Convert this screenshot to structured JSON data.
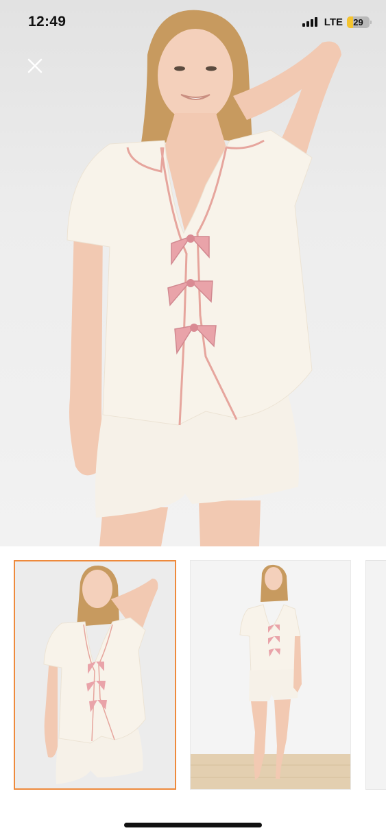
{
  "status_bar": {
    "time": "12:49",
    "network": "LTE",
    "battery": "29"
  },
  "hero": {
    "icon": "close-icon",
    "image": "product-photo-model-in-pajama-set"
  },
  "thumbnails": [
    {
      "image": "thumbnail-front-closeup",
      "selected": true
    },
    {
      "image": "thumbnail-full-body",
      "selected": false
    },
    {
      "image": "thumbnail-partial",
      "selected": false
    }
  ],
  "colors": {
    "selection_border": "#ee8a3c",
    "bow_pink": "#e9a3a9",
    "garment_cream": "#f8f3ea"
  }
}
